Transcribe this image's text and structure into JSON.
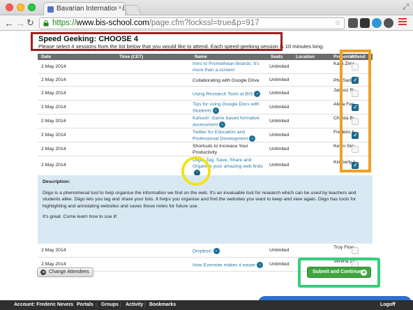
{
  "browser": {
    "tab_title": "Bavarian International Scho",
    "tab_close": "×",
    "url_protocol": "https://",
    "url_host": "www.bis-school.com",
    "url_path": "/page.cfm?lockssl=true&p=917",
    "star": "☆",
    "back": "←",
    "forward": "→",
    "reload": "C"
  },
  "heading": "Speed Geeking: CHOOSE 4",
  "instructions": "Please select 4 sessions from the list below that you would like to attend. Each speed-geeking session is 10 minutes long.",
  "columns": {
    "date": "Date",
    "time": "Time (CET)",
    "name": "Name",
    "seats": "Seats",
    "location": "Location",
    "presenter": "Presenter",
    "attend": "Attend"
  },
  "rows": [
    {
      "date": "2 May 2014",
      "name": "Intro to Promethean Boards: It's more than a screen!",
      "seats": "Unlimited",
      "presenter": "Kara Zimmerman",
      "checked": false
    },
    {
      "date": "2 May 2014",
      "name": "Collaborating with Google Drive",
      "seats": "Unlimited",
      "presenter": "Phil Sarli",
      "checked": true
    },
    {
      "date": "2 May 2014",
      "name": "Using Research Tools at BIS",
      "seats": "Unlimited",
      "presenter": "Janusz Rzonca",
      "checked": false
    },
    {
      "date": "2 May 2014",
      "name": "Tips for using Google Docs with Students",
      "seats": "Unlimited",
      "presenter": "Alicia Fenney",
      "checked": true
    },
    {
      "date": "2 May 2014",
      "name": "Kahoot!: Game based formative assessment",
      "seats": "Unlimited",
      "presenter": "Christa Bender",
      "checked": false
    },
    {
      "date": "2 May 2014",
      "name": "Twitter for Education and Professional Development",
      "seats": "Unlimited",
      "presenter": "Frederic Nevers",
      "checked": true
    },
    {
      "date": "2 May 2014",
      "name": "Shortcuts to Increase Your Productivity",
      "seats": "Unlimited",
      "presenter": "Kevin Skidmore",
      "checked": false
    },
    {
      "date": "2 May 2014",
      "name": "Diigo: Tag, Save, Share and Organise your amazing web finds",
      "seats": "Unlimited",
      "presenter": "Kimberly House",
      "checked": true
    },
    {
      "date": "2 May 2014",
      "name": "Dropbox!",
      "seats": "Unlimited",
      "presenter": "Troy Flowers",
      "checked": false
    },
    {
      "date": "2 May 2014",
      "name": "How Evernote makes it easier",
      "seats": "Unlimited",
      "presenter": "Verena Zimmer",
      "checked": false
    }
  ],
  "description": {
    "title": "Description:",
    "body": "Diigo is a phenomenal tool to help organise the information we find on the web. It's an invaluable tool for research which can be used by teachers and students alike. Diigo lets you tag and share your lists. It helps you organise and find the websites you want to keep and view again. Diigo has tools for highlighting and annotating websites and saves those notes for future use.",
    "closing": "It's great. Come learn how to use it!"
  },
  "buttons": {
    "change": "Change Attendees",
    "submit": "Submit and Continue"
  },
  "footer": {
    "account": "Account: Frederic Nevers",
    "portals": "Portals",
    "groups": "Groups",
    "activity": "Activity",
    "bookmarks": "Bookmarks",
    "logoff": "Logoff",
    "separator": "|"
  }
}
